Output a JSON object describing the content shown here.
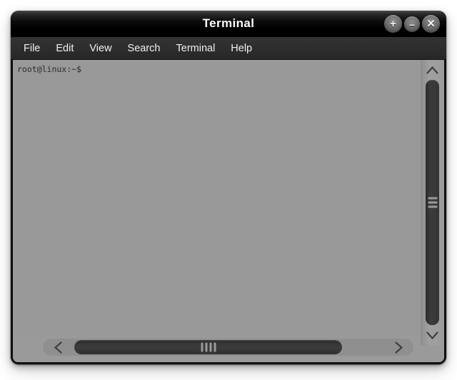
{
  "window": {
    "title": "Terminal",
    "controls": [
      {
        "name": "maximize-button",
        "glyph": "+",
        "label": "Maximize"
      },
      {
        "name": "minimize-button",
        "glyph": "–",
        "label": "Minimize"
      },
      {
        "name": "close-button",
        "glyph": "✕",
        "label": "Close"
      }
    ]
  },
  "menubar": {
    "items": [
      {
        "label": "File"
      },
      {
        "label": "Edit"
      },
      {
        "label": "View"
      },
      {
        "label": "Search"
      },
      {
        "label": "Terminal"
      },
      {
        "label": "Help"
      }
    ]
  },
  "terminal": {
    "prompt": "root@linux:~$",
    "lines": [
      "root@linux:~$"
    ],
    "background_color": "#999999",
    "text_color": "#2b2b2b"
  },
  "scrollbars": {
    "vertical": {
      "up_arrow_icon": "chevron-up-icon",
      "down_arrow_icon": "chevron-down-icon",
      "thumb_grip_lines": 3
    },
    "horizontal": {
      "left_arrow_icon": "chevron-left-icon",
      "right_arrow_icon": "chevron-right-icon",
      "thumb_grip_lines": 4
    }
  },
  "theme": {
    "titlebar_color": "#000000",
    "menubar_color": "#2d2d2d",
    "chrome_color": "#9a9a9a",
    "border_color": "#0f0f0f",
    "desktop_color": "#ffffff"
  }
}
